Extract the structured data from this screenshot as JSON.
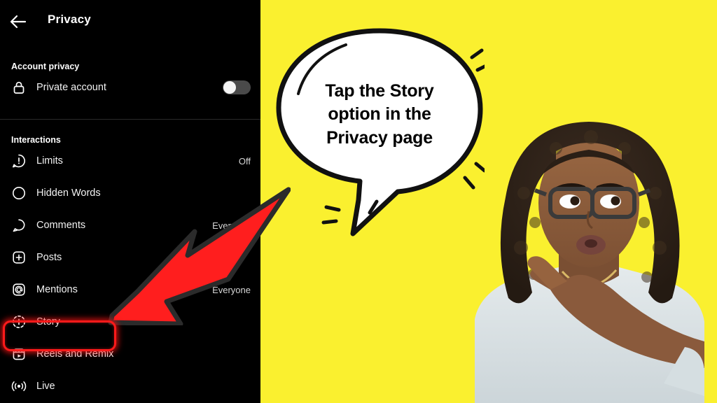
{
  "colors": {
    "backdrop_yellow": "#FAF02F",
    "panel_black": "#000000",
    "highlight_red": "#FF1A1A",
    "arrow_red": "#FF1E1E",
    "arrow_outline": "#2B2B2B",
    "bubble_white": "#FFFFFF",
    "bubble_outline": "#111111",
    "text_white": "#F2F2F2",
    "value_gray": "#D6D6D6",
    "divider_gray": "#2A2A2A",
    "toggle_track": "#4A4A4A",
    "toggle_knob": "#F5F5F5"
  },
  "phone": {
    "header": {
      "back_icon": "back-arrow-icon",
      "title": "Privacy"
    },
    "sections": [
      {
        "label": "Account privacy",
        "rows": [
          {
            "icon": "lock-icon",
            "label": "Private account",
            "control": "toggle",
            "toggle_on": false,
            "value": ""
          }
        ]
      },
      {
        "label": "Interactions",
        "rows": [
          {
            "icon": "limits-icon",
            "label": "Limits",
            "control": "value",
            "value": "Off"
          },
          {
            "icon": "hidden-words-icon",
            "label": "Hidden Words",
            "control": "value",
            "value": ""
          },
          {
            "icon": "comment-icon",
            "label": "Comments",
            "control": "value",
            "value": "Everyone"
          },
          {
            "icon": "posts-icon",
            "label": "Posts",
            "control": "value",
            "value": ""
          },
          {
            "icon": "mentions-icon",
            "label": "Mentions",
            "control": "value",
            "value": "Everyone"
          },
          {
            "icon": "story-icon",
            "label": "Story",
            "control": "value",
            "value": "",
            "highlighted": true
          },
          {
            "icon": "reels-icon",
            "label": "Reels and Remix",
            "control": "value",
            "value": ""
          },
          {
            "icon": "live-icon",
            "label": "Live",
            "control": "value",
            "value": ""
          }
        ]
      }
    ]
  },
  "callout": {
    "bubble_text": "Tap the Story option in the Privacy page",
    "bubble_line_1": "Tap the Story",
    "bubble_line_2": "option in the",
    "bubble_line_3": "Privacy page",
    "arrow": "red-arrow-pointing-down-left"
  },
  "photo": {
    "description": "woman-with-glasses-pointing",
    "skin": "#8A5A3C",
    "hair": "#2C2018",
    "shirt": "#DCE3E6",
    "glasses": "#3A3A3A"
  }
}
